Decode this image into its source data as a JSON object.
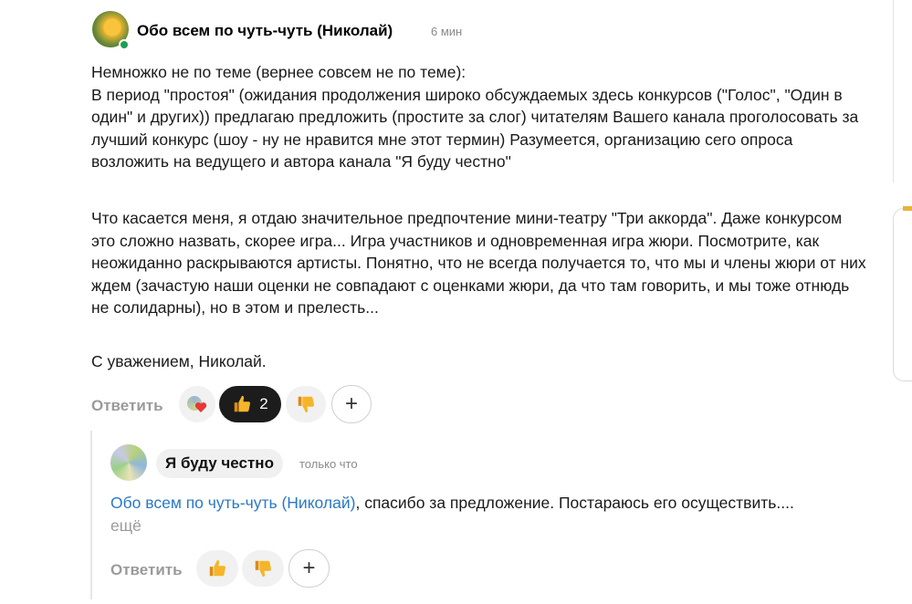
{
  "comment": {
    "author": "Обо всем по чуть-чуть (Николай)",
    "time": "6 мин",
    "paragraphs": [
      "Немножко не по теме (вернее совсем не по теме):\nВ период \"простоя\" (ожидания продолжения широко обсуждаемых здесь конкурсов (\"Голос\", \"Один в один\" и других)) предлагаю предложить (простите за слог) читателям Вашего канала проголосовать за лучший конкурс (шоу - ну не нравится мне этот термин) Разумеется, организацию сего опроса возложить на ведущего и автора канала \"Я буду честно\"",
      "Что касается меня, я отдаю значительное предпочтение мини-театру \"Три аккорда\". Даже конкурсом это сложно назвать, скорее игра... Игра участников и одновременная игра жюри. Посмотрите, как неожиданно раскрываются артисты. Понятно, что не всегда получается то, что мы и члены жюри от них ждем (зачастую наши оценки не совпадают с оценками жюри, да что там говорить, и мы тоже отнюдь не солидарны), но в этом и прелесть...",
      "С уважением, Николай."
    ],
    "reply_label": "Ответить",
    "like_count": "2",
    "like_active": true
  },
  "reply": {
    "author": "Я буду честно",
    "time": "только что",
    "mention": "Обо всем по чуть-чуть (Николай)",
    "text": ", спасибо за предложение. Постараюсь его осуществить....",
    "more": "ещё",
    "reply_label": "Ответить"
  },
  "icons": {
    "like": "thumbs-up-icon",
    "dislike": "thumbs-down-icon",
    "add": "plus-icon",
    "heart": "heart-avatar-icon"
  },
  "colors": {
    "mention": "#2a78c8",
    "muted": "#9a9a9a",
    "active_reaction_bg": "#1c1c1c",
    "online": "#1f9d55",
    "thumb": "#f2a91e"
  }
}
